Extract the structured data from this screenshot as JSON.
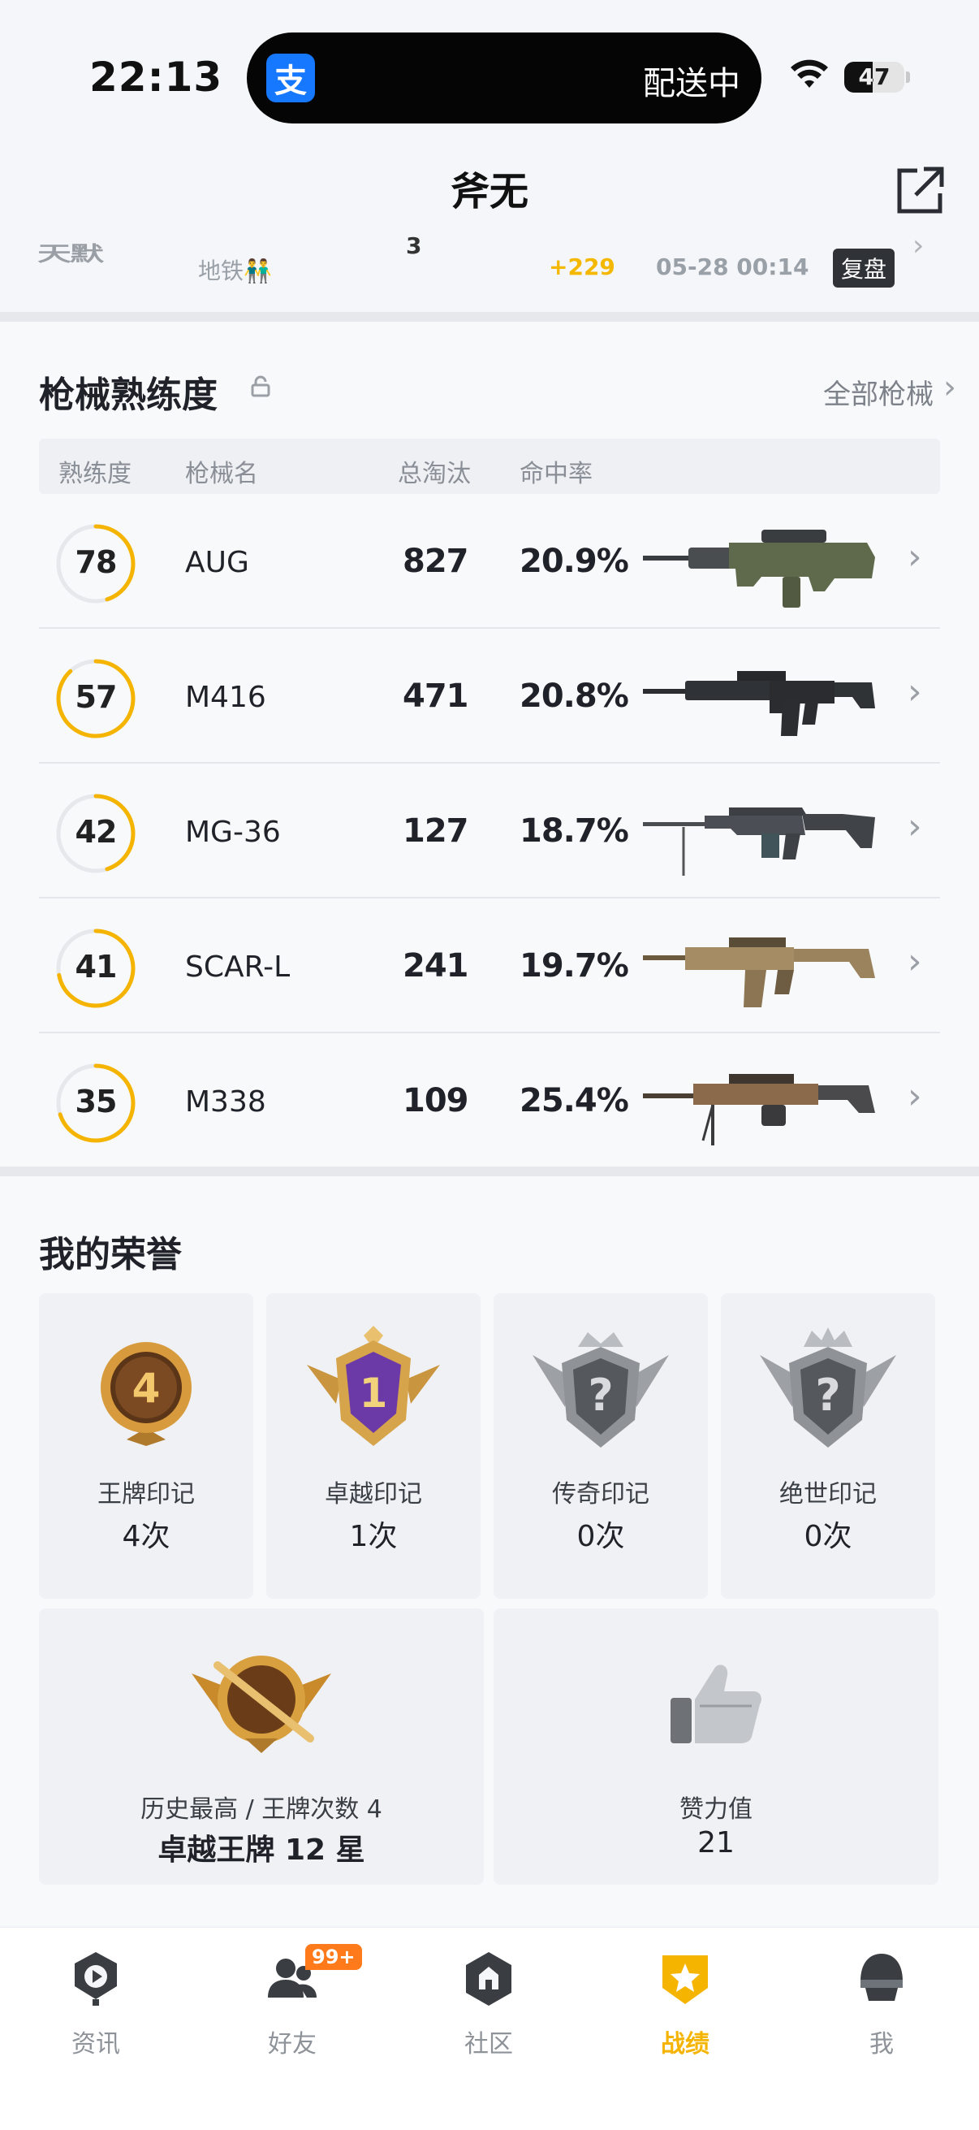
{
  "status_bar": {
    "time": "22:13",
    "island_app_icon": "支",
    "island_text": "配送中",
    "battery": "47",
    "battery_level": 0.47
  },
  "nav": {
    "title": "斧无"
  },
  "prev_record": {
    "logo_text": "天默",
    "mode": "地铁👬",
    "rank": "3",
    "score": "+229",
    "date": "05-28 00:14",
    "replay_label": "复盘"
  },
  "weapons": {
    "title": "枪械熟练度",
    "all_label": "全部枪械",
    "headers": [
      "熟练度",
      "枪械名",
      "总淘汰",
      "命中率"
    ],
    "rows": [
      {
        "level": "78",
        "progress": 0.45,
        "name": "AUG",
        "kills": "827",
        "accuracy": "20.9%"
      },
      {
        "level": "57",
        "progress": 0.88,
        "name": "M416",
        "kills": "471",
        "accuracy": "20.8%"
      },
      {
        "level": "42",
        "progress": 0.45,
        "name": "MG-36",
        "kills": "127",
        "accuracy": "18.7%"
      },
      {
        "level": "41",
        "progress": 0.72,
        "name": "SCAR-L",
        "kills": "241",
        "accuracy": "19.7%"
      },
      {
        "level": "35",
        "progress": 0.7,
        "name": "M338",
        "kills": "109",
        "accuracy": "25.4%"
      }
    ]
  },
  "honors": {
    "title": "我的荣誉",
    "marks": [
      {
        "name": "王牌印记",
        "count": "4次",
        "badge_text": "4"
      },
      {
        "name": "卓越印记",
        "count": "1次",
        "badge_text": "1"
      },
      {
        "name": "传奇印记",
        "count": "0次",
        "badge_text": "?"
      },
      {
        "name": "绝世印记",
        "count": "0次",
        "badge_text": "?"
      }
    ],
    "highest": {
      "label": "历史最高 / 王牌次数 4",
      "value": "卓越王牌 12 星"
    },
    "likes": {
      "label": "赞力值",
      "value": "21"
    }
  },
  "tabbar": {
    "items": [
      {
        "label": "资讯",
        "icon": "news-icon"
      },
      {
        "label": "好友",
        "icon": "friends-icon",
        "badge": "99+"
      },
      {
        "label": "社区",
        "icon": "community-icon"
      },
      {
        "label": "战绩",
        "icon": "record-icon",
        "active": true
      },
      {
        "label": "我",
        "icon": "profile-icon"
      }
    ]
  },
  "colors": {
    "accent": "#f5b400",
    "background": "#f4f6f9",
    "ring_track": "#e6e8ec"
  }
}
